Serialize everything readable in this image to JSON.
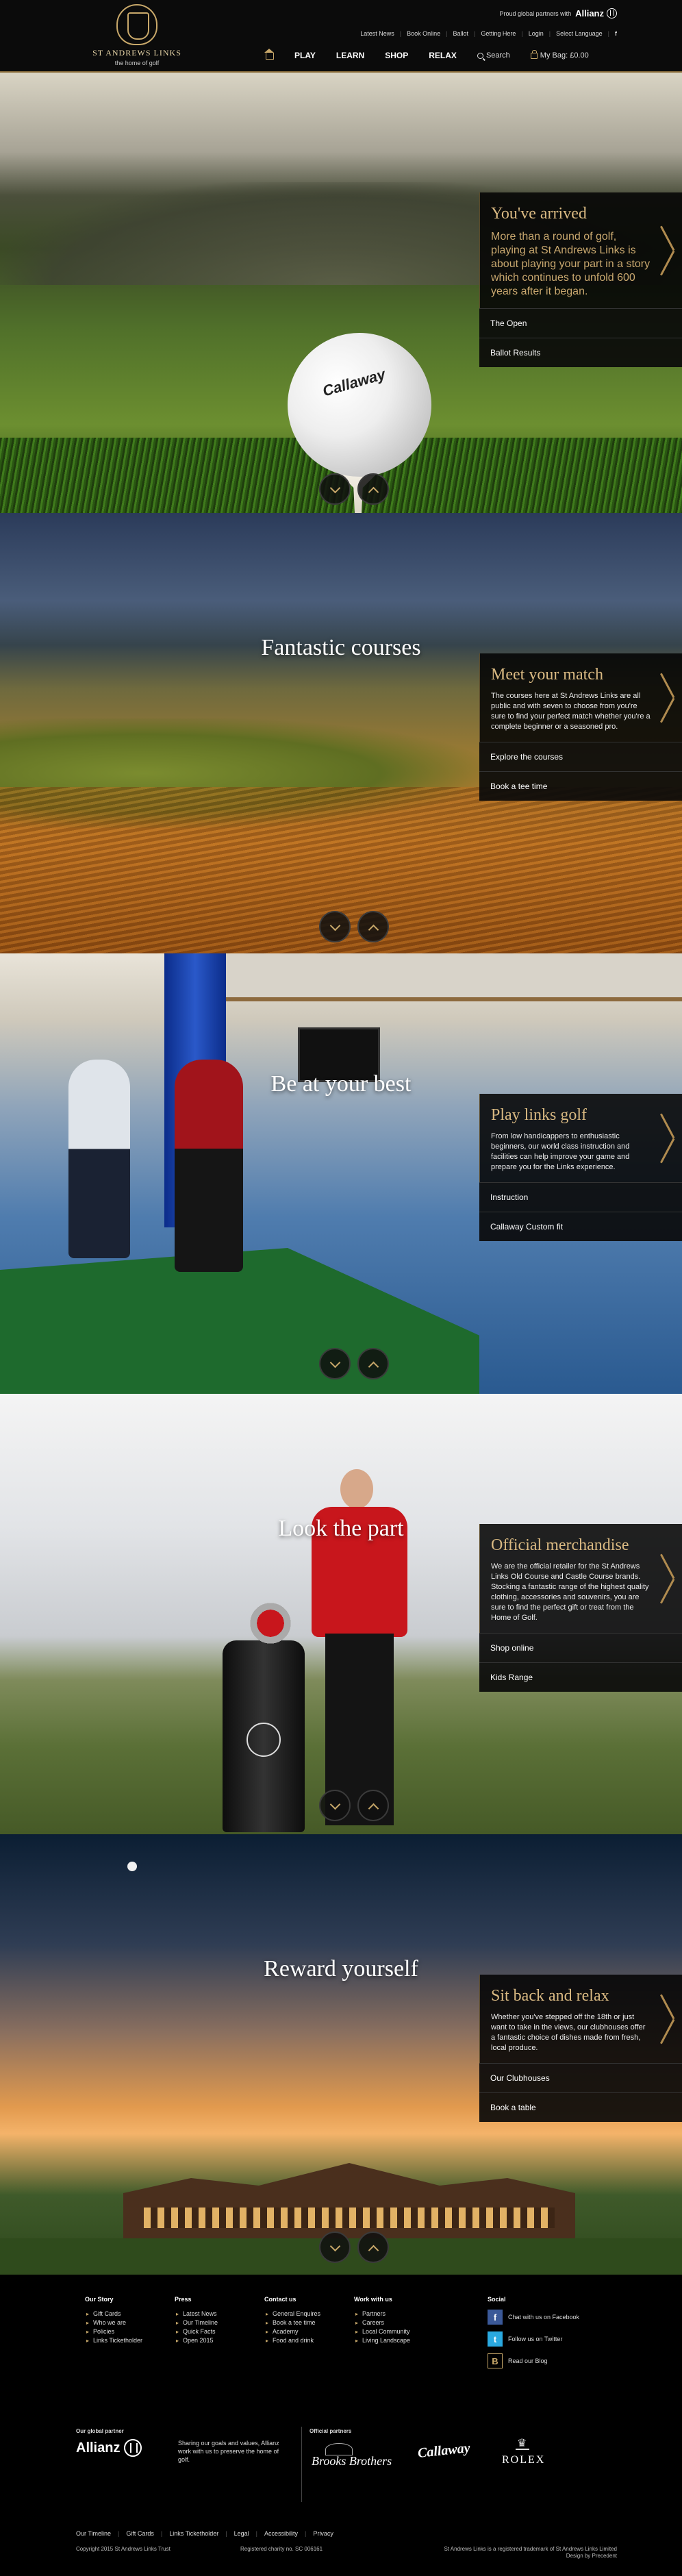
{
  "header": {
    "logo_name": "ST ANDREWS LINKS",
    "logo_tagline": "the home of golf",
    "partner_text": "Proud global partners with",
    "partner_brand": "Allianz",
    "utility_links": [
      "Latest News",
      "Book Online",
      "Ballot",
      "Getting Here",
      "Login",
      "Select Language"
    ],
    "social_f": "f",
    "nav": [
      "PLAY",
      "LEARN",
      "SHOP",
      "RELAX"
    ],
    "search_label": "Search",
    "bag_label": "My Bag: £0.00"
  },
  "sections": [
    {
      "title": "",
      "panel_heading": "You've arrived",
      "panel_text": "More than a round of golf, playing at St Andrews Links is about playing your part in a story which continues to unfold 600 years after it began.",
      "links": [
        "The Open",
        "Ballot Results"
      ],
      "ball_text": "Callaway"
    },
    {
      "title": "Fantastic courses",
      "panel_heading": "Meet your match",
      "panel_text": "The courses here at St Andrews Links are all public and with seven to choose from you're sure to find your perfect match whether you're a complete beginner or a seasoned pro.",
      "links": [
        "Explore the courses",
        "Book a tee time"
      ]
    },
    {
      "title": "Be at your best",
      "panel_heading": "Play links golf",
      "panel_text": "From low handicappers to enthusiastic beginners, our world class instruction and facilities can help improve your game and prepare you for the Links experience.",
      "links": [
        "Instruction",
        "Callaway Custom fit"
      ]
    },
    {
      "title": "Look the part",
      "panel_heading": "Official merchandise",
      "panel_text": "We are the official retailer for the St Andrews Links Old Course and Castle Course brands. Stocking a fantastic range of the highest quality clothing, accessories and souvenirs, you are sure to find the perfect gift or treat from the Home of Golf.",
      "links": [
        "Shop online",
        "Kids Range"
      ]
    },
    {
      "title": "Reward yourself",
      "panel_heading": "Sit back and relax",
      "panel_text": "Whether you've stepped off the 18th or just want to take in the views, our clubhouses offer a fantastic choice of dishes made from fresh, local produce.",
      "links": [
        "Our Clubhouses",
        "Book a table"
      ]
    }
  ],
  "footer": {
    "columns": [
      {
        "heading": "Our Story",
        "items": [
          "Gift Cards",
          "Who we are",
          "Policies",
          "Links Ticketholder"
        ]
      },
      {
        "heading": "Press",
        "items": [
          "Latest News",
          "Our Timeline",
          "Quick Facts",
          "Open 2015"
        ]
      },
      {
        "heading": "Contact us",
        "items": [
          "General Enquires",
          "Book a tee time",
          "Academy",
          "Food and drink"
        ]
      },
      {
        "heading": "Work with us",
        "items": [
          "Partners",
          "Careers",
          "Local Community",
          "Living Landscape"
        ]
      }
    ],
    "social": {
      "heading": "Social",
      "items": [
        {
          "icon": "f",
          "label": "Chat with us on Facebook"
        },
        {
          "icon": "t",
          "label": "Follow us on Twitter"
        },
        {
          "icon": "B",
          "label": "Read our Blog"
        }
      ]
    },
    "global_partner_label": "Our global partner",
    "global_partner_brand": "Allianz",
    "global_partner_copy": "Sharing our goals and values, Allianz work with us to preserve the home of golf.",
    "official_partners_label": "Official partners",
    "official_partners": [
      "Brooks Brothers",
      "Callaway",
      "ROLEX"
    ],
    "legal_links": [
      "Our Timeline",
      "Gift Cards",
      "Links Ticketholder",
      "Legal",
      "Accessibility",
      "Privacy"
    ],
    "copyright": "Copyright 2015 St Andrews Links Trust",
    "charity": "Registered charity no. SC 006161",
    "trademark": "St Andrews Links is a registered trademark of St Andrews Links Limited",
    "design_credit": "Design by Precedent"
  },
  "colors": {
    "accent_gold": "#c8a86a",
    "panel_heading": "#d9b982",
    "background": "#000000"
  }
}
